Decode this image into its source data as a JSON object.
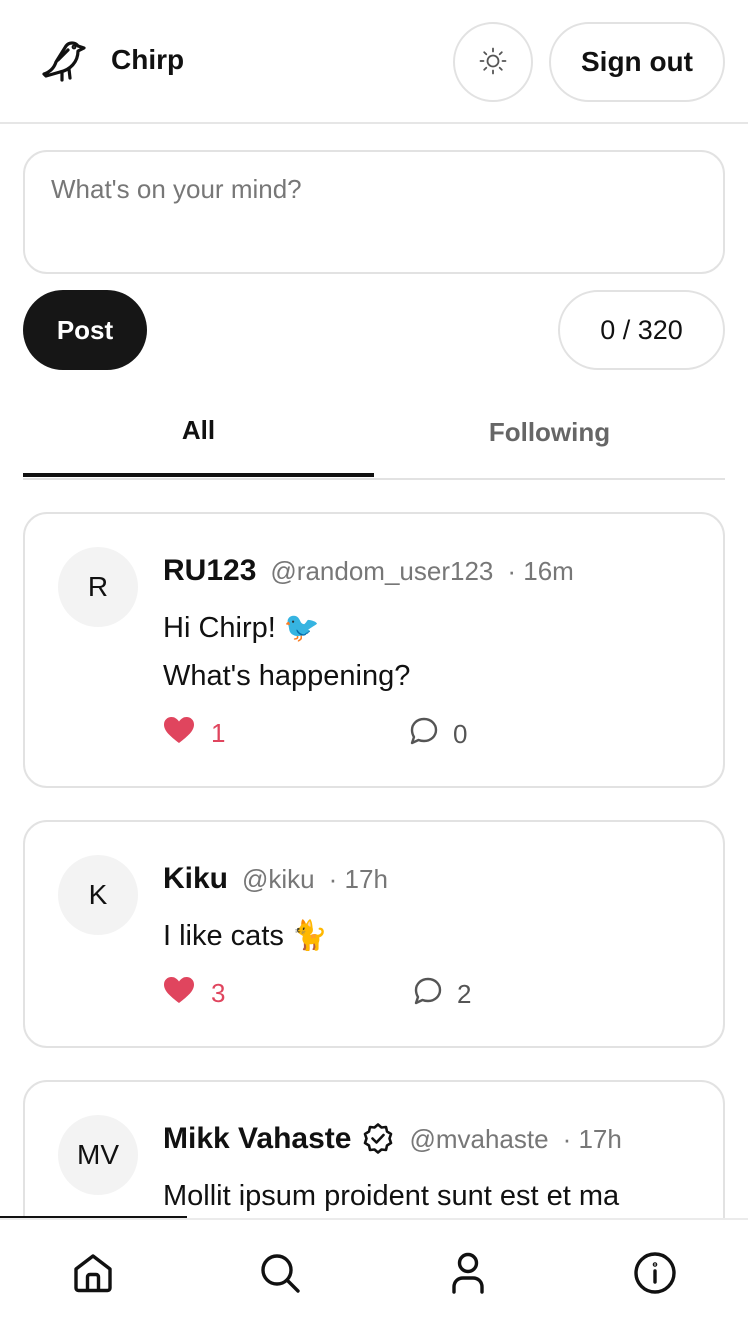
{
  "header": {
    "brand": "Chirp",
    "signout_label": "Sign out",
    "logo_icon": "bird-icon",
    "theme_icon": "sun-icon"
  },
  "composer": {
    "placeholder": "What's on your mind?",
    "value": "",
    "post_label": "Post",
    "counter": "0 / 320"
  },
  "tabs": [
    {
      "label": "All",
      "active": true
    },
    {
      "label": "Following",
      "active": false
    }
  ],
  "posts": [
    {
      "avatar": "R",
      "name": "RU123",
      "handle": "@random_user123",
      "time": "· 16m",
      "verified": false,
      "lines": [
        "Hi Chirp! 🐦",
        "What's happening?"
      ],
      "likes": "1",
      "comments": "0"
    },
    {
      "avatar": "K",
      "name": "Kiku",
      "handle": "@kiku",
      "time": "· 17h",
      "verified": false,
      "lines": [
        "I like cats 🐈"
      ],
      "likes": "3",
      "comments": "2"
    },
    {
      "avatar": "MV",
      "name": "Mikk Vahaste",
      "handle": "@mvahaste",
      "time": "· 17h",
      "verified": true,
      "lines": [
        "Mollit ipsum proident sunt est et ma"
      ],
      "likes": "",
      "comments": ""
    }
  ],
  "bottom_nav": [
    {
      "icon": "home-icon"
    },
    {
      "icon": "search-icon"
    },
    {
      "icon": "profile-icon"
    },
    {
      "icon": "info-icon"
    }
  ],
  "colors": {
    "accent": "#161616",
    "like": "#e0455e",
    "border": "#e2e2e2"
  }
}
